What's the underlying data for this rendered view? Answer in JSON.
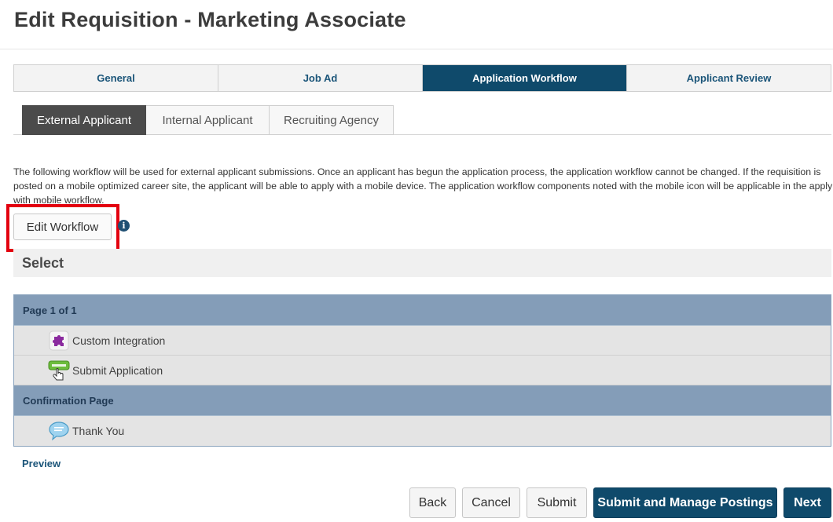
{
  "page": {
    "title": "Edit Requisition - Marketing Associate"
  },
  "main_tabs": [
    {
      "label": "General"
    },
    {
      "label": "Job Ad"
    },
    {
      "label": "Application Workflow"
    },
    {
      "label": "Applicant Review"
    }
  ],
  "main_tabs_active": "Application Workflow",
  "sub_tabs": [
    {
      "label": "External Applicant"
    },
    {
      "label": "Internal Applicant"
    },
    {
      "label": "Recruiting Agency"
    }
  ],
  "sub_tabs_active": "External Applicant",
  "description": "The following workflow will be used for external applicant submissions. Once an applicant has begun the application process, the application workflow cannot be changed. If the requisition is posted on a mobile optimized career site, the applicant will be able to apply with a mobile device. The application workflow components noted with the mobile icon will be applicable in the apply with mobile workflow.",
  "edit_workflow": {
    "label": "Edit Workflow",
    "info_icon": "info-icon"
  },
  "select_heading": "Select",
  "workflow": {
    "page_header": "Page 1 of 1",
    "items": [
      {
        "label": "Custom Integration",
        "icon": "puzzle-icon"
      },
      {
        "label": "Submit Application",
        "icon": "submit-hand-icon"
      }
    ],
    "confirmation_header": "Confirmation Page",
    "confirmation_items": [
      {
        "label": "Thank You",
        "icon": "speech-bubble-icon"
      }
    ]
  },
  "preview_link": "Preview",
  "footer": {
    "back": "Back",
    "cancel": "Cancel",
    "submit": "Submit",
    "submit_manage": "Submit and Manage Postings",
    "next": "Next"
  },
  "colors": {
    "highlight": "#e3000f",
    "active_tab": "#0f4a6b",
    "workflow_header": "#849db8"
  }
}
